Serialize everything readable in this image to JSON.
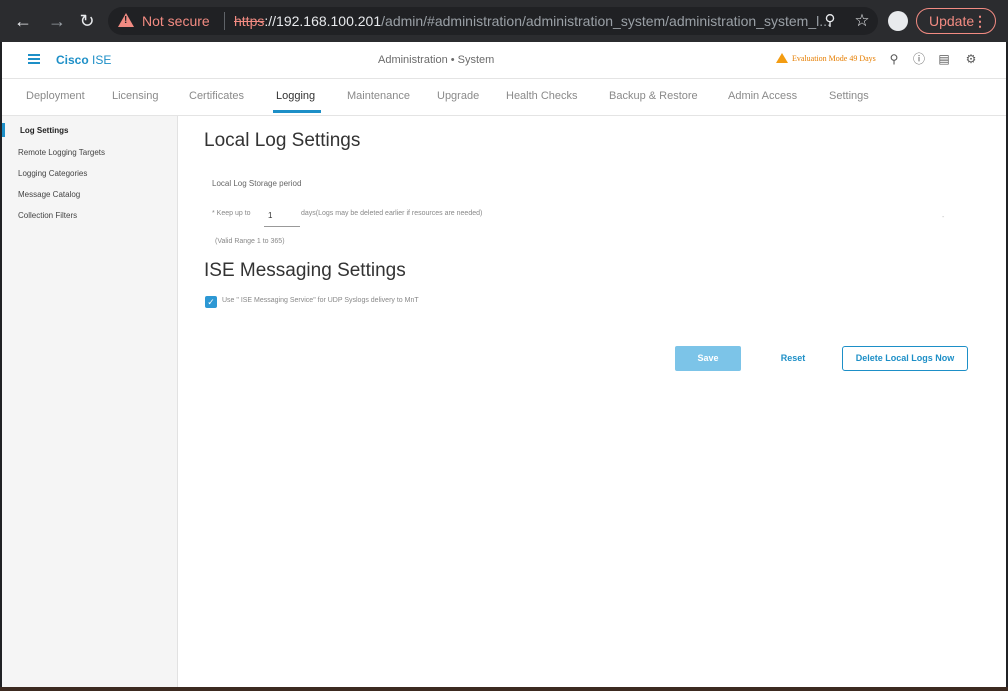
{
  "browser": {
    "not_secure": "Not secure",
    "url_proto": "https",
    "url_host": "://192.168.100.201",
    "url_path": "/admin/#administration/administration_system/administration_system_l...",
    "update_label": "Update",
    "update_dots": "⋮"
  },
  "header": {
    "brand_bold": "Cisco",
    "brand_rest": " ISE",
    "context": "Administration • System",
    "evaluation": "Evaluation Mode 49 Days"
  },
  "tabs": [
    {
      "label": "Deployment"
    },
    {
      "label": "Licensing"
    },
    {
      "label": "Certificates"
    },
    {
      "label": "Logging"
    },
    {
      "label": "Maintenance"
    },
    {
      "label": "Upgrade"
    },
    {
      "label": "Health Checks"
    },
    {
      "label": "Backup & Restore"
    },
    {
      "label": "Admin Access"
    },
    {
      "label": "Settings"
    }
  ],
  "active_tab": "Logging",
  "sidebar": {
    "items": [
      {
        "label": "Log Settings"
      },
      {
        "label": "Remote Logging Targets"
      },
      {
        "label": "Logging Categories"
      },
      {
        "label": "Message Catalog"
      },
      {
        "label": "Collection Filters"
      }
    ]
  },
  "main": {
    "local_title": "Local Log Settings",
    "storage_label": "Local Log Storage period",
    "keep_up_to": "* Keep up to",
    "days_value": "1",
    "days_note": "days(Logs may be deleted earlier if resources are needed)",
    "valid_range": "(Valid Range 1 to 365)",
    "messaging_title": "ISE Messaging Settings",
    "messaging_checkbox_label": "Use \" ISE Messaging Service\" for UDP Syslogs delivery to MnT",
    "messaging_checked": true,
    "save_label": "Save",
    "reset_label": "Reset",
    "delete_label": "Delete Local Logs Now"
  },
  "colors": {
    "accent": "#1d8fc7",
    "warning": "#f39c12",
    "not_secure": "#f28b82"
  }
}
